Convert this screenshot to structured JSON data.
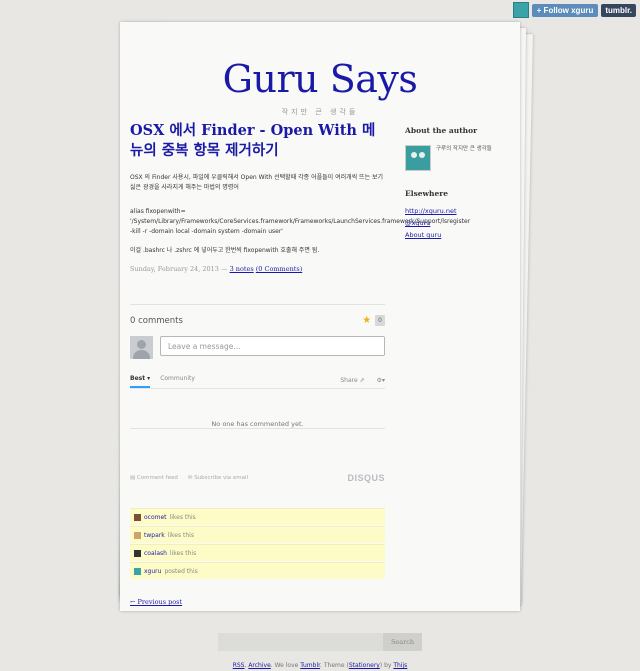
{
  "tumblr_bar": {
    "follow_label": "+ Follow xguru",
    "tumblr_label": "tumblr."
  },
  "blog": {
    "title": "Guru Says",
    "subtitle": "작지만 큰 생각들"
  },
  "post": {
    "title": "OSX 에서 Finder - Open With 메뉴의 중복 항목 제거하기",
    "description": "OSX 의 Finder 사용시, 파일에 우클릭해서 Open With 선택할때 각종 어플들이 여러개씩 뜨는 보기싫은 광경을 사라지게 해주는 마법의 명령어",
    "code_lines": [
      "alias fixopenwith=",
      "'/System/Library/Frameworks/CoreServices.framework/Frameworks/LaunchServices.framework/Support/lsregister",
      " -kill -r -domain local -domain system -domain user'"
    ],
    "note": "이걸 .bashrc 나 .zshrc 에 넣어두고 한번씩 fixopenwith 호출해 주면 됨.",
    "meta": {
      "date": "Sunday, February 24, 2013 —",
      "notes_link": "3 notes",
      "comments_link": "(0 Comments)"
    }
  },
  "disqus": {
    "count_label": "0 comments",
    "recommend_count": "0",
    "placeholder": "Leave a message...",
    "tabs": {
      "best": "Best ▾",
      "community": "Community",
      "share": "Share ⇗",
      "settings": "⚙▾"
    },
    "empty_text": "No one has commented yet.",
    "comment_feed": "Comment feed",
    "subscribe": "Subscribe via email",
    "logo": "DISQUS"
  },
  "notes": [
    {
      "user": "ocomet",
      "action": "likes this",
      "color": "#7a4f3a"
    },
    {
      "user": "twpark",
      "action": "likes this",
      "color": "#c9a56b"
    },
    {
      "user": "coalash",
      "action": "likes this",
      "color": "#333333"
    },
    {
      "user": "xguru",
      "action": "posted this",
      "color": "#3aa3a8"
    }
  ],
  "older_link": "← Previous post",
  "sidebar": {
    "about_heading": "About the author",
    "author_desc": "구루의 작지만 큰 생각들",
    "elsewhere_heading": "Elsewhere",
    "links": [
      "http://xguru.net",
      "@xguru",
      "About guru"
    ]
  },
  "search": {
    "button": "Search"
  },
  "footer": {
    "rss": "RSS",
    "archive": "Archive",
    "we_love": ". We love ",
    "tumblr": "Tumblr",
    "theme": ". Theme (",
    "stationery": "Stationery",
    "by": ") by ",
    "author": "Thijs"
  },
  "colors": {
    "link": "#1a1aa6",
    "background": "#e8e7e3",
    "note_bg": "#fefcc6"
  }
}
